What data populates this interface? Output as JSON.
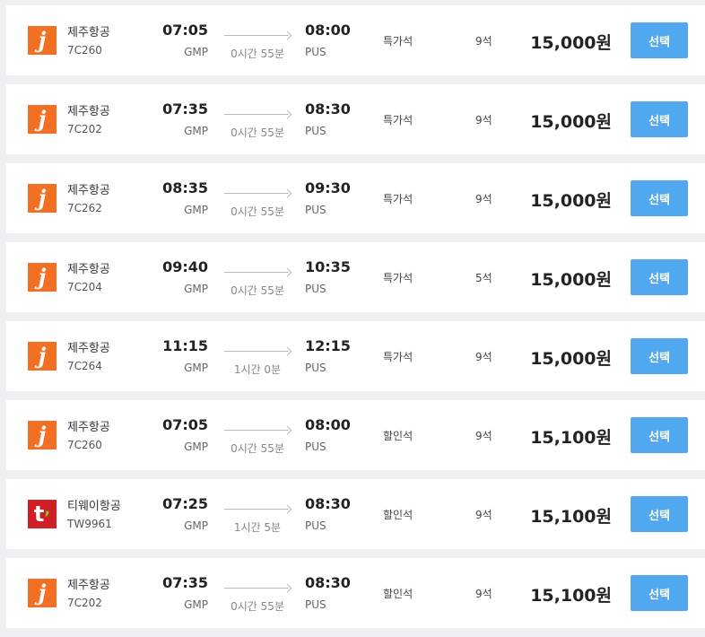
{
  "flights": [
    {
      "airline": "제주항공",
      "logo": "jeju",
      "logo_text": "j",
      "flight_no": "7C260",
      "dep_time": "07:05",
      "dep_code": "GMP",
      "duration": "0시간 55분",
      "arr_time": "08:00",
      "arr_code": "PUS",
      "seat_class": "특가석",
      "seats": "9석",
      "price": "15,000원",
      "button": "선택"
    },
    {
      "airline": "제주항공",
      "logo": "jeju",
      "logo_text": "j",
      "flight_no": "7C202",
      "dep_time": "07:35",
      "dep_code": "GMP",
      "duration": "0시간 55분",
      "arr_time": "08:30",
      "arr_code": "PUS",
      "seat_class": "특가석",
      "seats": "9석",
      "price": "15,000원",
      "button": "선택"
    },
    {
      "airline": "제주항공",
      "logo": "jeju",
      "logo_text": "j",
      "flight_no": "7C262",
      "dep_time": "08:35",
      "dep_code": "GMP",
      "duration": "0시간 55분",
      "arr_time": "09:30",
      "arr_code": "PUS",
      "seat_class": "특가석",
      "seats": "9석",
      "price": "15,000원",
      "button": "선택"
    },
    {
      "airline": "제주항공",
      "logo": "jeju",
      "logo_text": "j",
      "flight_no": "7C204",
      "dep_time": "09:40",
      "dep_code": "GMP",
      "duration": "0시간 55분",
      "arr_time": "10:35",
      "arr_code": "PUS",
      "seat_class": "특가석",
      "seats": "5석",
      "price": "15,000원",
      "button": "선택"
    },
    {
      "airline": "제주항공",
      "logo": "jeju",
      "logo_text": "j",
      "flight_no": "7C264",
      "dep_time": "11:15",
      "dep_code": "GMP",
      "duration": "1시간 0분",
      "arr_time": "12:15",
      "arr_code": "PUS",
      "seat_class": "특가석",
      "seats": "9석",
      "price": "15,000원",
      "button": "선택"
    },
    {
      "airline": "제주항공",
      "logo": "jeju",
      "logo_text": "j",
      "flight_no": "7C260",
      "dep_time": "07:05",
      "dep_code": "GMP",
      "duration": "0시간 55분",
      "arr_time": "08:00",
      "arr_code": "PUS",
      "seat_class": "할인석",
      "seats": "9석",
      "price": "15,100원",
      "button": "선택"
    },
    {
      "airline": "티웨이항공",
      "logo": "tway",
      "logo_text": "t",
      "flight_no": "TW9961",
      "dep_time": "07:25",
      "dep_code": "GMP",
      "duration": "1시간 5분",
      "arr_time": "08:30",
      "arr_code": "PUS",
      "seat_class": "할인석",
      "seats": "9석",
      "price": "15,100원",
      "button": "선택"
    },
    {
      "airline": "제주항공",
      "logo": "jeju",
      "logo_text": "j",
      "flight_no": "7C202",
      "dep_time": "07:35",
      "dep_code": "GMP",
      "duration": "0시간 55분",
      "arr_time": "08:30",
      "arr_code": "PUS",
      "seat_class": "할인석",
      "seats": "9석",
      "price": "15,100원",
      "button": "선택"
    }
  ],
  "colors": {
    "select_button": "#52a8ee",
    "jeju_logo": "#f36f21",
    "tway_logo": "#cf2027",
    "tway_accent": "#8fc31f"
  }
}
